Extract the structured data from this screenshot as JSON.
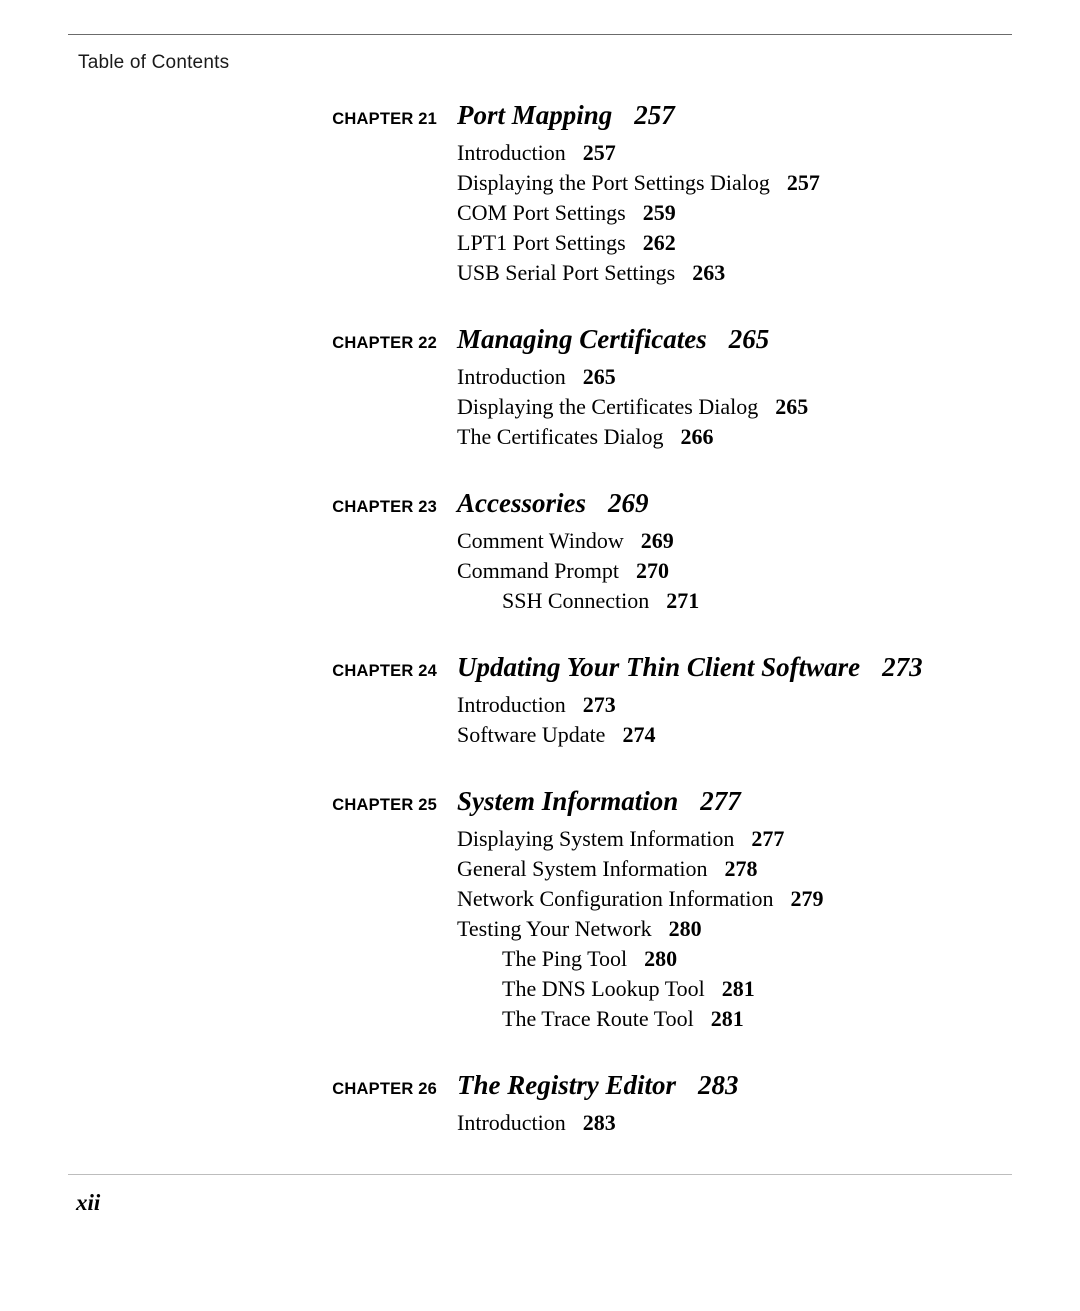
{
  "header": {
    "running_head": "Table of Contents"
  },
  "footer": {
    "folio": "xii"
  },
  "toc": {
    "chapters": [
      {
        "label": "CHAPTER 21",
        "title": "Port Mapping",
        "page": "257",
        "entries": [
          {
            "text": "Introduction",
            "page": "257",
            "level": 1
          },
          {
            "text": "Displaying the Port Settings Dialog",
            "page": "257",
            "level": 1
          },
          {
            "text": "COM Port Settings",
            "page": "259",
            "level": 1
          },
          {
            "text": "LPT1 Port Settings",
            "page": "262",
            "level": 1
          },
          {
            "text": "USB Serial Port Settings",
            "page": "263",
            "level": 1
          }
        ]
      },
      {
        "label": "CHAPTER 22",
        "title": "Managing Certificates",
        "page": "265",
        "entries": [
          {
            "text": "Introduction",
            "page": "265",
            "level": 1
          },
          {
            "text": "Displaying the Certificates Dialog",
            "page": "265",
            "level": 1
          },
          {
            "text": "The Certificates Dialog",
            "page": "266",
            "level": 1
          }
        ]
      },
      {
        "label": "CHAPTER 23",
        "title": "Accessories",
        "page": "269",
        "entries": [
          {
            "text": "Comment Window",
            "page": "269",
            "level": 1
          },
          {
            "text": "Command Prompt",
            "page": "270",
            "level": 1
          },
          {
            "text": "SSH Connection",
            "page": "271",
            "level": 2
          }
        ]
      },
      {
        "label": "CHAPTER 24",
        "title": "Updating Your Thin Client Software",
        "page": "273",
        "entries": [
          {
            "text": "Introduction",
            "page": "273",
            "level": 1
          },
          {
            "text": "Software Update",
            "page": "274",
            "level": 1
          }
        ]
      },
      {
        "label": "CHAPTER 25",
        "title": "System Information",
        "page": "277",
        "entries": [
          {
            "text": "Displaying System Information",
            "page": "277",
            "level": 1
          },
          {
            "text": "General System Information",
            "page": "278",
            "level": 1
          },
          {
            "text": "Network Configuration Information",
            "page": "279",
            "level": 1
          },
          {
            "text": "Testing Your Network",
            "page": "280",
            "level": 1
          },
          {
            "text": "The Ping Tool",
            "page": "280",
            "level": 2
          },
          {
            "text": "The DNS Lookup Tool",
            "page": "281",
            "level": 2
          },
          {
            "text": "The Trace Route Tool",
            "page": "281",
            "level": 2
          }
        ]
      },
      {
        "label": "CHAPTER 26",
        "title": "The Registry Editor",
        "page": "283",
        "entries": [
          {
            "text": "Introduction",
            "page": "283",
            "level": 1
          }
        ]
      }
    ]
  }
}
